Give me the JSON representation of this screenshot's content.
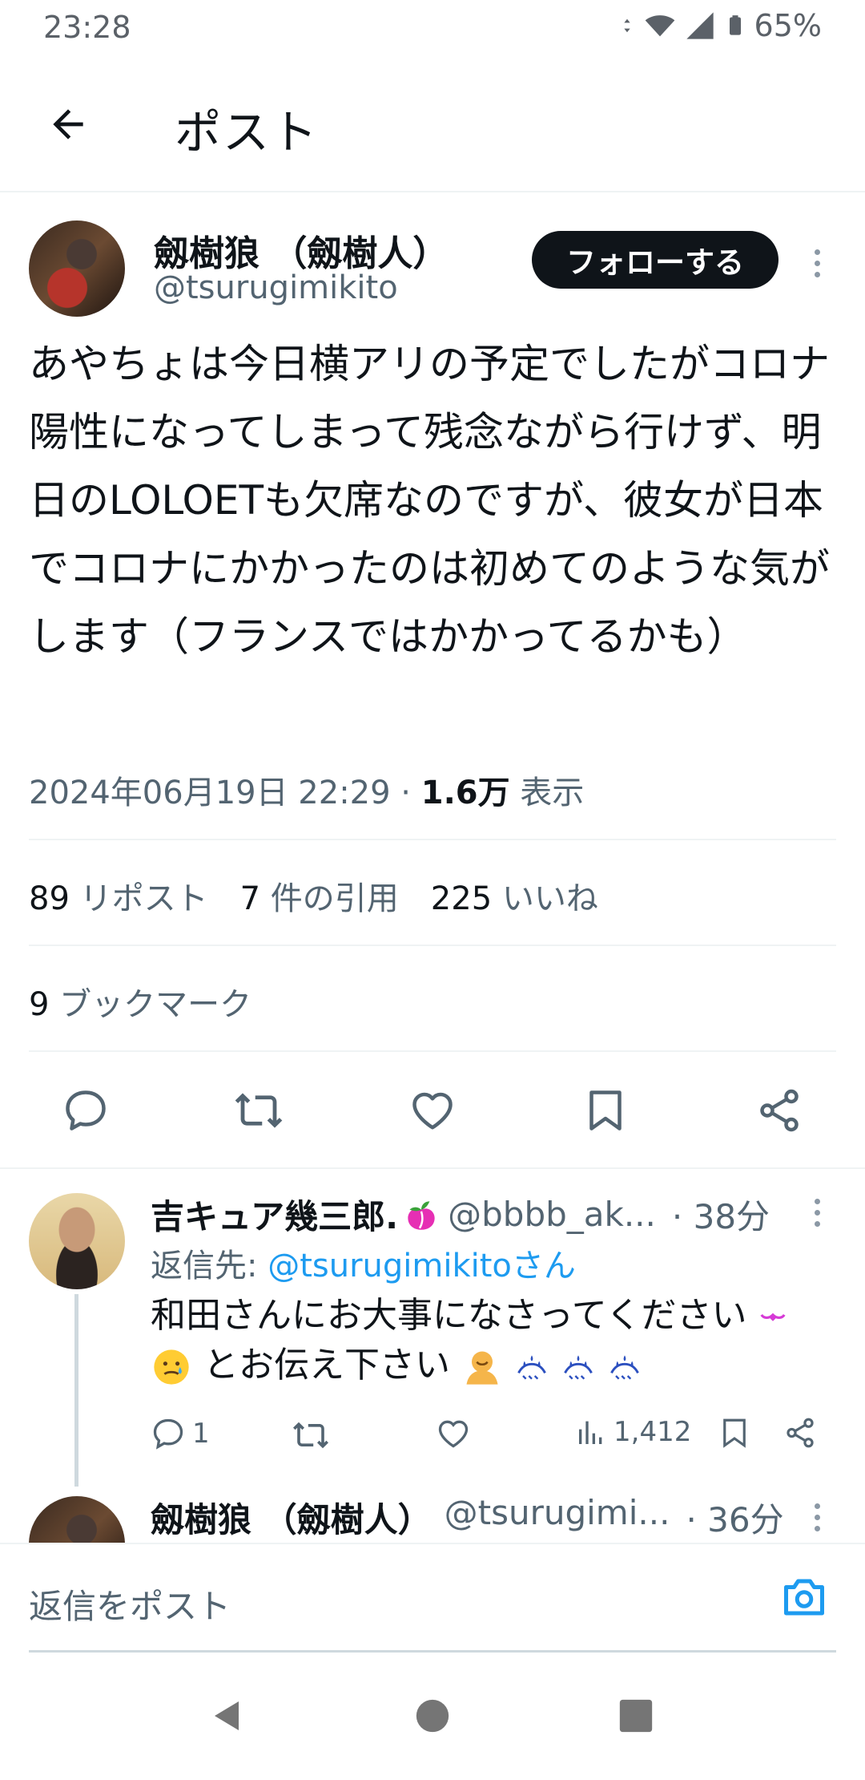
{
  "status_bar": {
    "time": "23:28",
    "battery": "65%"
  },
  "header": {
    "title": "ポスト"
  },
  "post": {
    "author_name": "劔樹狼 （劔樹人）",
    "author_handle": "@tsurugimikito",
    "follow_label": "フォローする",
    "text": "あやちょは今日横アリの予定でしたがコロナ陽性になってしまって残念ながら行けず、明日のLOLOETも欠席なのですが、彼女が日本でコロナにかかったのは初めてのような気がします（フランスではかかってるかも）",
    "timestamp": "2024年06月19日 22:29 · ",
    "views_count": "1.6万",
    "views_label": " 表示",
    "reposts_count": "89",
    "reposts_label": " リポスト",
    "quotes_count": "7",
    "quotes_label": " 件の引用",
    "likes_count": "225",
    "likes_label": " いいね",
    "bookmarks_count": "9",
    "bookmarks_label": " ブックマーク"
  },
  "reply": {
    "author_name": "吉キュア幾三郎.",
    "author_handle": "@bbbb_ak...",
    "time": "· 38分",
    "reply_to_prefix": "返信先: ",
    "reply_to_handle": "@tsurugimikitoさん",
    "text_line1": "和田さんにお大事になさってください",
    "text_line2": "とお伝え下さい",
    "comments": "1",
    "views": "1,412"
  },
  "reply2": {
    "author_name": "劔樹狼 （劔樹人）",
    "author_handle": "@tsurugimi...",
    "time": "· 36分"
  },
  "composer": {
    "placeholder": "返信をポスト"
  },
  "icons": {
    "back": "arrow-left-icon",
    "comment": "comment-icon",
    "repost": "repost-icon",
    "like": "heart-icon",
    "bookmark": "bookmark-icon",
    "share": "share-icon",
    "camera": "camera-icon"
  },
  "colors": {
    "accent": "#1d9bf0",
    "text": "#0f1419",
    "muted": "#536471",
    "follow_bg": "#0f1419"
  }
}
